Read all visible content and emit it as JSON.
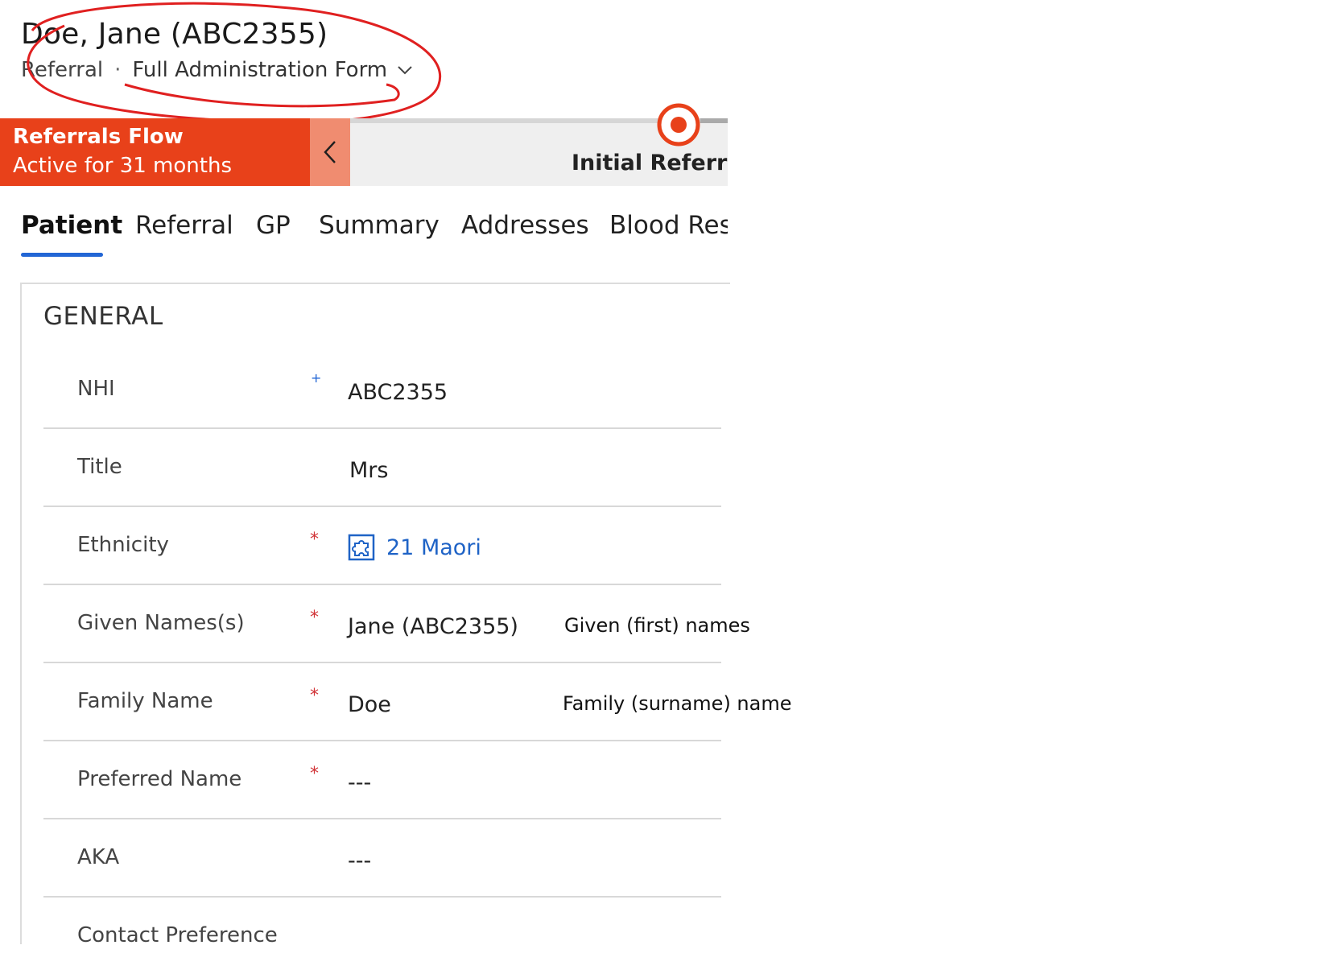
{
  "header": {
    "record_title": "Doe, Jane (ABC2355)",
    "entity": "Referral",
    "separator": "·",
    "form_name": "Full Administration Form"
  },
  "process": {
    "flow_name": "Referrals Flow",
    "flow_status": "Active for 31 months",
    "active_stage": "Initial Referral (",
    "colors": {
      "flow": "#e8411a",
      "collapse": "#f08c70",
      "marker": "#e8411a"
    }
  },
  "tabs": [
    {
      "label": "Patient"
    },
    {
      "label": "Referral"
    },
    {
      "label": "GP"
    },
    {
      "label": "Summary"
    },
    {
      "label": "Addresses"
    },
    {
      "label": "Blood Res"
    }
  ],
  "section": {
    "title": "GENERAL",
    "fields": [
      {
        "label": "NHI",
        "marker": "+",
        "value": "ABC2355",
        "note": ""
      },
      {
        "label": "Title",
        "marker": "",
        "value": "Mrs",
        "note": ""
      },
      {
        "label": "Ethnicity",
        "marker": "*",
        "value": "21 Maori",
        "note": ""
      },
      {
        "label": "Given Names(s)",
        "marker": "*",
        "value": "Jane (ABC2355)",
        "note": "Given (first) names"
      },
      {
        "label": "Family Name",
        "marker": "*",
        "value": "Doe",
        "note": "Family (surname) name"
      },
      {
        "label": "Preferred Name",
        "marker": "*",
        "value": "---",
        "note": ""
      },
      {
        "label": "AKA",
        "marker": "",
        "value": "---",
        "note": ""
      },
      {
        "label": "Contact Preference",
        "marker": "",
        "value": "",
        "note": ""
      }
    ]
  },
  "icons": {
    "chevron": "chevron-down-icon",
    "collapse": "chevron-left-icon",
    "stage": "target-stage-icon",
    "lookup": "puzzle-entity-icon"
  },
  "annotation_color": "#e02020"
}
